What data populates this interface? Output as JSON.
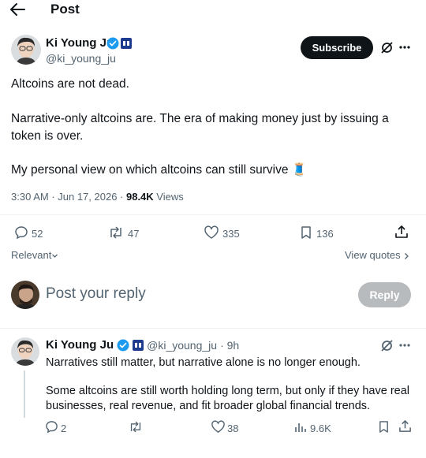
{
  "header": {
    "title": "Post"
  },
  "post": {
    "author_name": "Ki Young Ju",
    "handle": "@ki_young_ju",
    "subscribe_label": "Subscribe",
    "paragraphs": [
      "Altcoins are not dead.",
      "Narrative-only altcoins are. The era of making money just by issuing a",
      "token is over.",
      "My personal view on which altcoins can still survive"
    ],
    "emoji": "🧵",
    "time": "3:30 AM · Jun 17, 2026 · ",
    "views_count": "98.4K",
    "views_label": " Views",
    "stats": {
      "replies": "52",
      "reposts": "47",
      "likes": "335",
      "bookmarks": "136"
    },
    "sort_label": "Relevant",
    "view_quotes_label": "View quotes"
  },
  "composer": {
    "placeholder": "Post your reply",
    "reply_label": "Reply"
  },
  "reply": {
    "author_name": "Ki Young Ju",
    "handle": "@ki_young_ju",
    "time": "· 9h",
    "lines": [
      "Narratives still matter, but narrative alone is no longer enough.",
      "Some altcoins are still worth holding long term, but only if they have real",
      "businesses, real revenue, and fit broader global financial trends."
    ],
    "stats": {
      "replies": "2",
      "likes": "38",
      "views": "9.6K"
    }
  },
  "colors": {
    "accent": "#1d9bf0",
    "text": "#0f1419",
    "secondary": "#536471"
  }
}
